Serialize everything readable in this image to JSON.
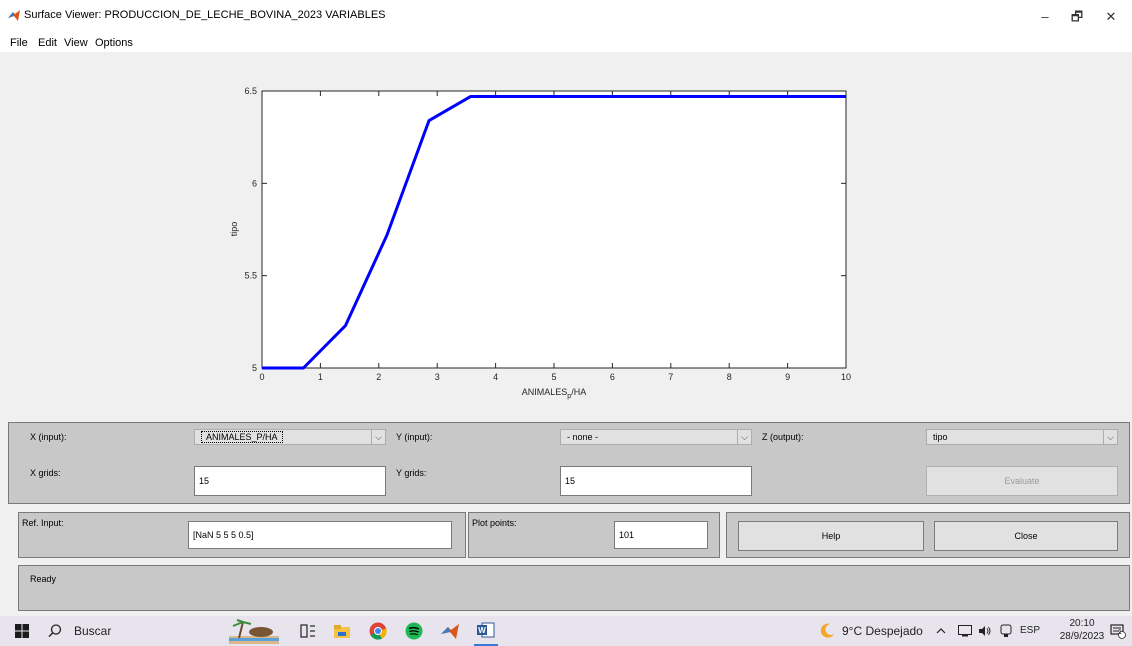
{
  "window": {
    "title": "Surface Viewer: PRODUCCION_DE_LECHE_BOVINA_2023 VARIABLES",
    "minimize_glyph": "–",
    "restore_glyph": "🗗",
    "close_glyph": "✕"
  },
  "menu": {
    "items": [
      "File",
      "Edit",
      "View",
      "Options"
    ]
  },
  "chart_data": {
    "type": "line",
    "xlabel": "ANIMALES",
    "xlabel_sub": "p",
    "xlabel_tail": "/HA",
    "ylabel": "tipo",
    "xlim": [
      0,
      10
    ],
    "ylim": [
      5,
      6.5
    ],
    "xticks": [
      "0",
      "1",
      "2",
      "3",
      "4",
      "5",
      "6",
      "7",
      "8",
      "9",
      "10"
    ],
    "yticks": [
      "5",
      "5.5",
      "6",
      "6.5"
    ],
    "series": [
      {
        "color": "#0000ff",
        "x": [
          0,
          0.71,
          1.43,
          2.14,
          2.86,
          3.57,
          10
        ],
        "y": [
          5.0,
          5.0,
          5.23,
          5.72,
          6.34,
          6.47,
          6.47
        ]
      }
    ]
  },
  "controls": {
    "x_input_label": "X (input):",
    "x_input_value": "ANIMALES_P/HA",
    "y_input_label": "Y (input):",
    "y_input_value": "- none -",
    "z_output_label": "Z (output):",
    "z_output_value": "tipo",
    "x_grids_label": "X grids:",
    "x_grids_value": "15",
    "y_grids_label": "Y grids:",
    "y_grids_value": "15",
    "evaluate_label": "Evaluate",
    "ref_input_label": "Ref. Input:",
    "ref_input_value": "[NaN 5 5 5 0.5]",
    "plot_points_label": "Plot points:",
    "plot_points_value": "101",
    "help_label": "Help",
    "close_label": "Close",
    "status": "Ready",
    "dropdown_glyph": "⌵"
  },
  "taskbar": {
    "search_placeholder": "Buscar",
    "weather": "9°C  Despejado",
    "lang": "ESP",
    "time": "20:10",
    "date": "28/9/2023",
    "notification_count": "1"
  }
}
